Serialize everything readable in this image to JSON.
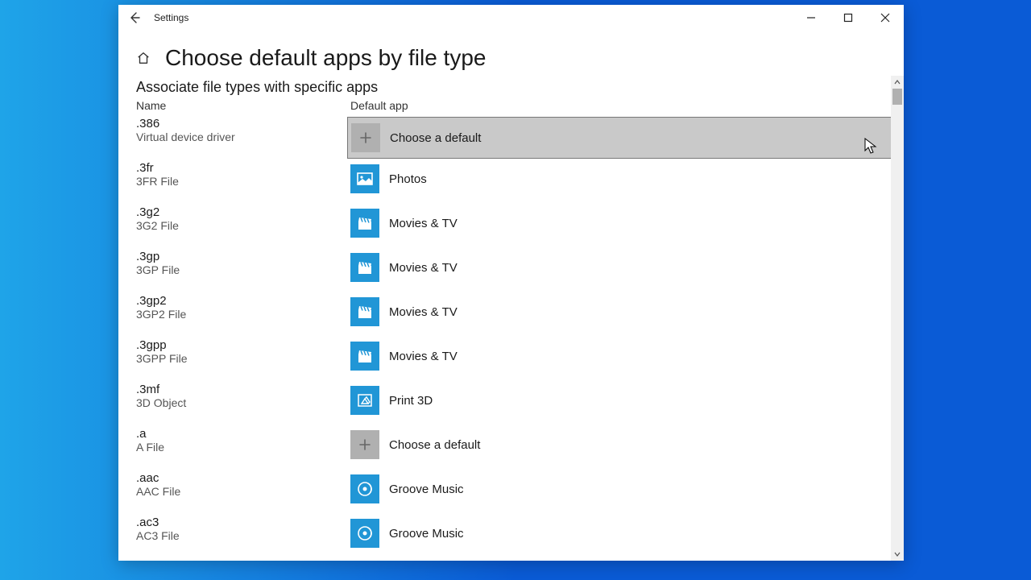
{
  "window": {
    "title": "Settings"
  },
  "page": {
    "title": "Choose default apps by file type",
    "subtitle": "Associate file types with specific apps",
    "col_name": "Name",
    "col_app": "Default app"
  },
  "labels": {
    "choose_default": "Choose a default",
    "photos": "Photos",
    "movies_tv": "Movies & TV",
    "print_3d": "Print 3D",
    "groove": "Groove Music"
  },
  "rows": [
    {
      "ext": ".386",
      "desc": "Virtual device driver",
      "app": "choose",
      "selected": true
    },
    {
      "ext": ".3fr",
      "desc": "3FR File",
      "app": "photos"
    },
    {
      "ext": ".3g2",
      "desc": "3G2 File",
      "app": "movies"
    },
    {
      "ext": ".3gp",
      "desc": "3GP File",
      "app": "movies"
    },
    {
      "ext": ".3gp2",
      "desc": "3GP2 File",
      "app": "movies"
    },
    {
      "ext": ".3gpp",
      "desc": "3GPP File",
      "app": "movies"
    },
    {
      "ext": ".3mf",
      "desc": "3D Object",
      "app": "print3d"
    },
    {
      "ext": ".a",
      "desc": "A File",
      "app": "choose"
    },
    {
      "ext": ".aac",
      "desc": "AAC File",
      "app": "groove"
    },
    {
      "ext": ".ac3",
      "desc": "AC3 File",
      "app": "groove"
    }
  ]
}
